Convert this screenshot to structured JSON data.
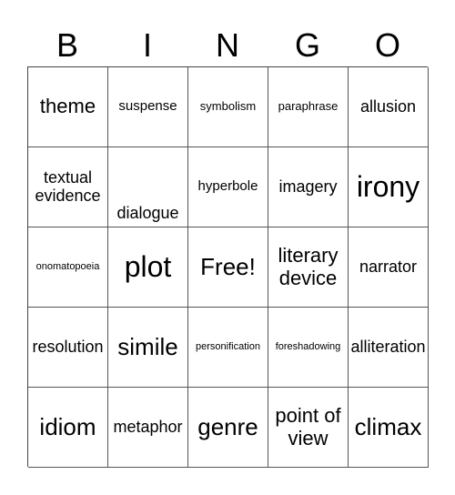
{
  "header": [
    "B",
    "I",
    "N",
    "G",
    "O"
  ],
  "cells": [
    [
      "theme",
      "suspense",
      "symbolism",
      "paraphrase",
      "allusion"
    ],
    [
      "textual evidence",
      "dialogue",
      "hyperbole",
      "imagery",
      "irony"
    ],
    [
      "onomatopoeia",
      "plot",
      "Free!",
      "literary device",
      "narrator"
    ],
    [
      "resolution",
      "simile",
      "personification",
      "foreshadowing",
      "alliteration"
    ],
    [
      "idiom",
      "metaphor",
      "genre",
      "point of view",
      "climax"
    ]
  ]
}
